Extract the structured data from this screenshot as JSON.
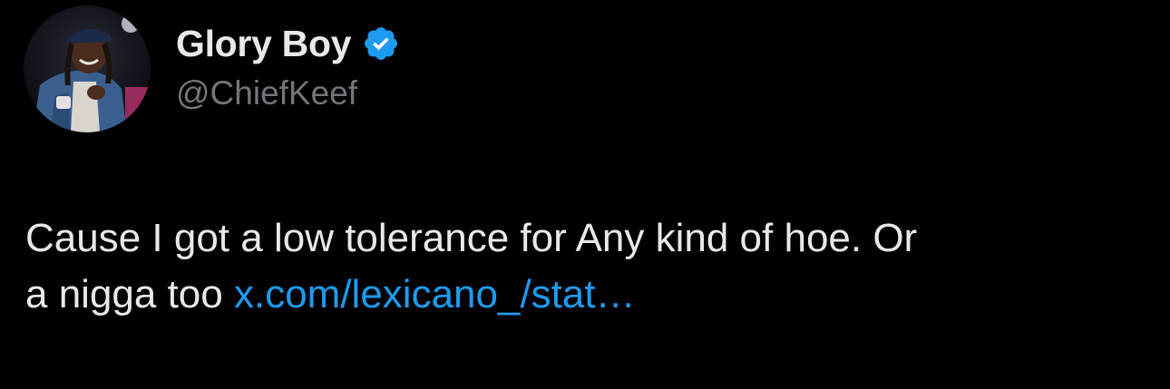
{
  "author": {
    "display_name": "Glory Boy",
    "handle": "@ChiefKeef",
    "verified": true,
    "avatar_icon": "profile-photo",
    "verified_icon": "verified-badge-icon"
  },
  "tweet": {
    "text_line1": "Cause I got a low tolerance for Any kind of hoe. Or",
    "text_line2": "a nigga too ",
    "link_text": "x.com/lexicano_/stat…"
  },
  "colors": {
    "background": "#000000",
    "text": "#e7e9ea",
    "secondary_text": "#71767b",
    "link": "#1d9bf0",
    "verified": "#1d9bf0"
  }
}
